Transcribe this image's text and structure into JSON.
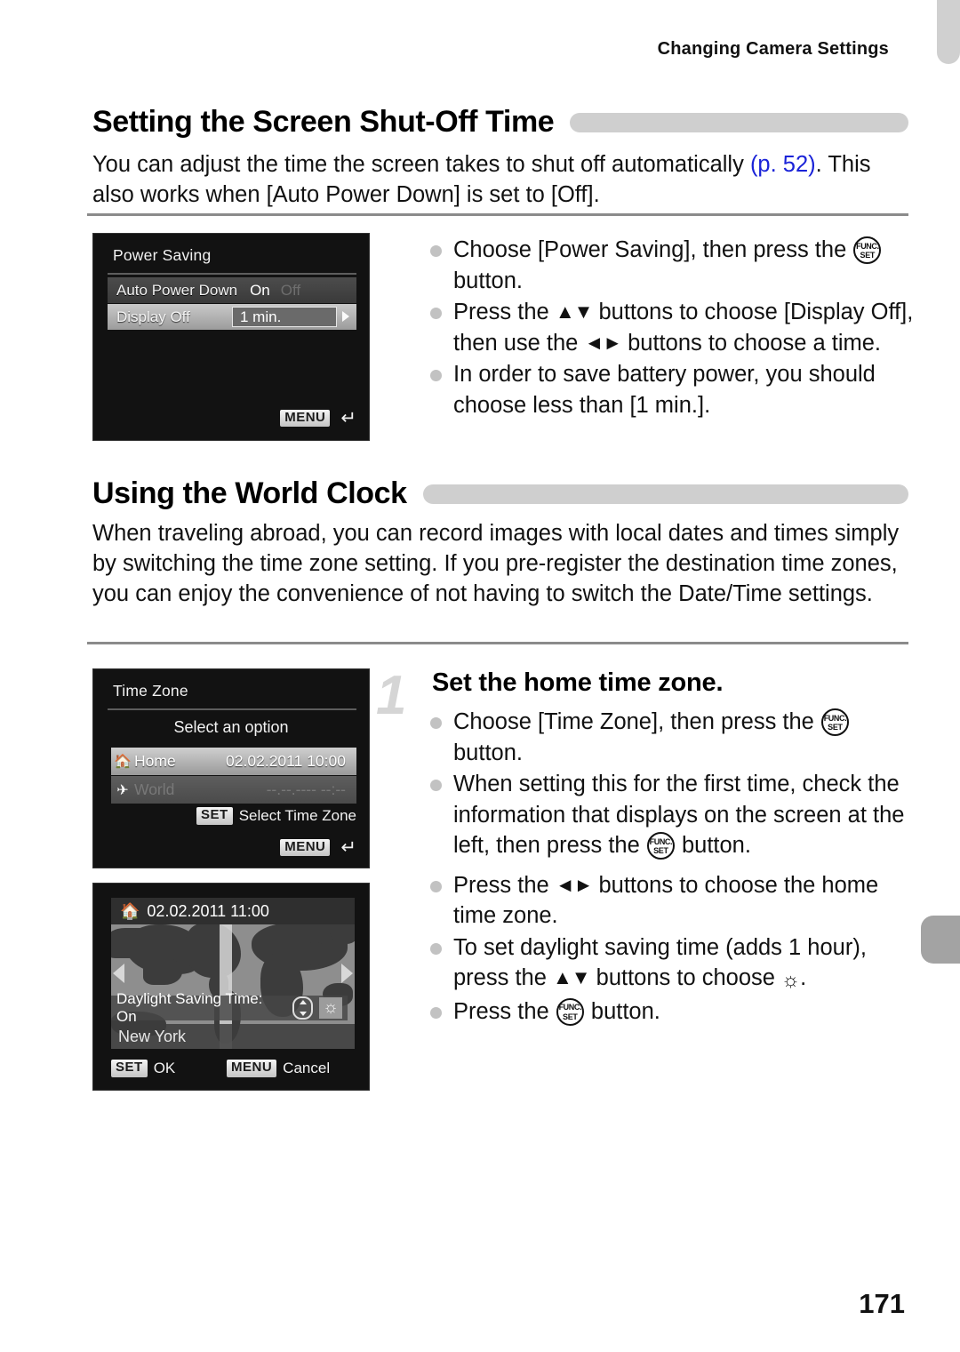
{
  "page": {
    "running_head": "Changing Camera Settings",
    "page_number": "171"
  },
  "sections": [
    {
      "id": "screen-shut-off",
      "heading": "Setting the Screen Shut-Off Time",
      "paragraph_part1": "You can adjust the time the screen takes to shut off automatically ",
      "paragraph_link": "(p. 52)",
      "paragraph_part2": ". This also works when [Auto Power Down] is set to [Off]."
    },
    {
      "id": "world-clock",
      "heading": "Using the World Clock",
      "paragraph": "When traveling abroad, you can record images with local dates and times simply by switching the time zone setting. If you pre-register the destination time zones, you can enjoy the convenience of not having to switch the Date/Time settings."
    }
  ],
  "power_saving_screen": {
    "title": "Power Saving",
    "row_auto_power_down": {
      "label": "Auto Power Down",
      "value_on": "On",
      "value_off": "Off"
    },
    "row_display_off": {
      "label": "Display Off",
      "value": "1 min."
    },
    "footer_badge": "MENU",
    "footer_return_icon": "return-arrow-icon"
  },
  "power_saving_bullets": [
    {
      "pre": "Choose [Power Saving], then press the ",
      "icon": "func-set-icon",
      "post": " button."
    },
    {
      "pre": "Press the ",
      "icon": "up-down-arrows-icon",
      "mid": " buttons to choose [Display Off], then use the ",
      "icon2": "left-right-arrows-icon",
      "post": " buttons to choose a time."
    },
    {
      "text": "In order to save battery power, you should choose less than [1 min.]."
    }
  ],
  "time_zone_screen": {
    "title": "Time Zone",
    "subtitle": "Select an option",
    "rows": [
      {
        "icon": "home-icon",
        "name": "Home",
        "date": "02.02.2011 10:00"
      },
      {
        "icon": "airplane-icon",
        "name": "World",
        "date": "--.--.---- --:--"
      }
    ],
    "footer_set_badge": "SET",
    "footer_set_label": "Select Time Zone",
    "footer_menu_badge": "MENU",
    "footer_return_icon": "return-arrow-icon"
  },
  "world_map_screen": {
    "icon": "home-icon",
    "datetime": "02.02.2011 11:00",
    "dst_label": "Daylight Saving Time: On",
    "dst_updown_icon": "up-down-pill-icon",
    "dst_sun_icon": "sun-icon",
    "city": "New York",
    "footer_set_badge": "SET",
    "footer_set_label": "OK",
    "footer_menu_badge": "MENU",
    "footer_menu_label": "Cancel",
    "nav_left_icon": "left-arrow-icon",
    "nav_right_icon": "right-arrow-icon"
  },
  "step": {
    "number": "1",
    "title": "Set the home time zone."
  },
  "world_clock_bullets": [
    {
      "pre": "Choose [Time Zone], then press the ",
      "icon": "func-set-icon",
      "post": " button."
    },
    {
      "pre": "When setting this for the first time, check the information that displays on the screen at the left, then press the ",
      "icon": "func-set-icon",
      "post": " button."
    },
    {
      "pre": "Press the ",
      "icon": "left-right-arrows-icon",
      "post": " buttons to choose the home time zone."
    },
    {
      "pre": "To set daylight saving time (adds 1 hour), press the ",
      "icon": "up-down-arrows-icon",
      "mid": " buttons to choose ",
      "icon2": "sun-icon",
      "post": "."
    },
    {
      "pre": "Press the ",
      "icon": "func-set-icon",
      "post": " button."
    }
  ],
  "colors": {
    "link": "#1a23d8",
    "heading_bar": "#cfcfcf",
    "rule": "#8b8b8b",
    "bullet_dot": "#c2c2c2",
    "step_number": "#d5d5d5"
  }
}
